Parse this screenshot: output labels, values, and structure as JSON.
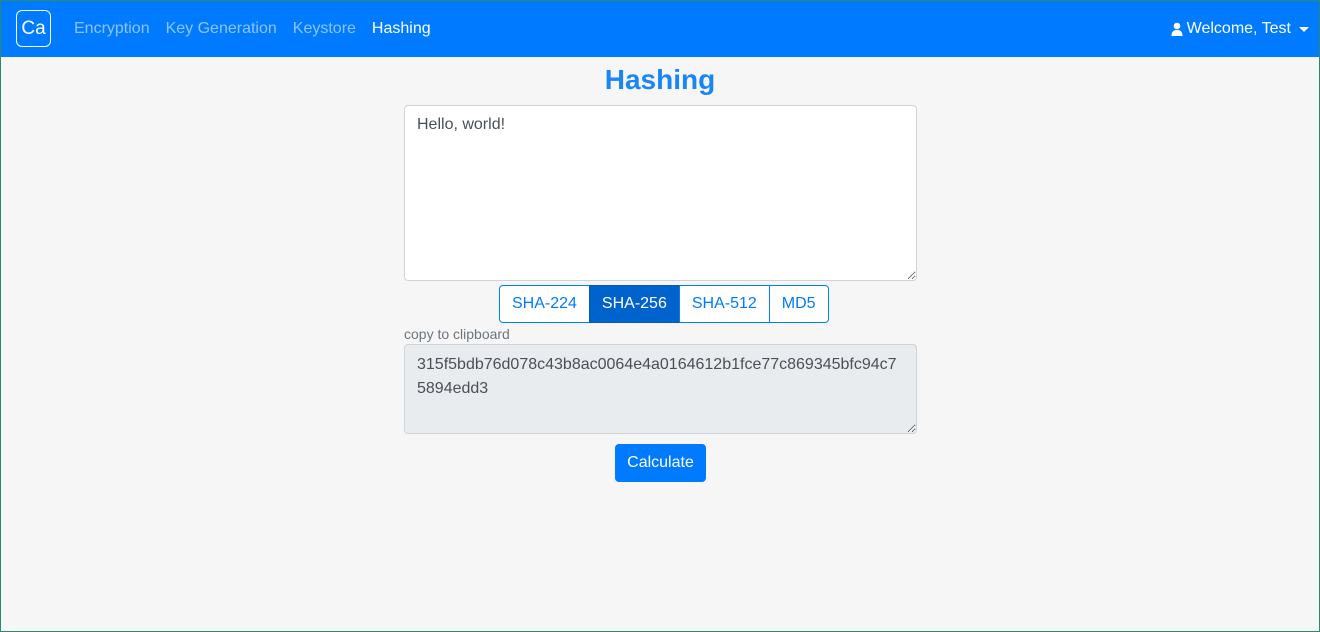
{
  "navbar": {
    "brand": "Ca",
    "links": [
      {
        "label": "Encryption"
      },
      {
        "label": "Key Generation"
      },
      {
        "label": "Keystore"
      },
      {
        "label": "Hashing"
      }
    ],
    "active_link": "Hashing",
    "user_label": "Welcome, Test",
    "user_icon": "user-icon"
  },
  "page": {
    "title": "Hashing"
  },
  "input": {
    "value": "Hello, world!"
  },
  "algorithms": {
    "options": [
      "SHA-224",
      "SHA-256",
      "SHA-512",
      "MD5"
    ],
    "selected": "SHA-256"
  },
  "output": {
    "copy_label": "copy to clipboard",
    "value": "315f5bdb76d078c43b8ac0064e4a0164612b1fce77c869345bfc94c75894edd3"
  },
  "actions": {
    "calculate_label": "Calculate"
  },
  "colors": {
    "primary": "#007bff",
    "active_button": "#0062cc",
    "title": "#1a86f5"
  }
}
